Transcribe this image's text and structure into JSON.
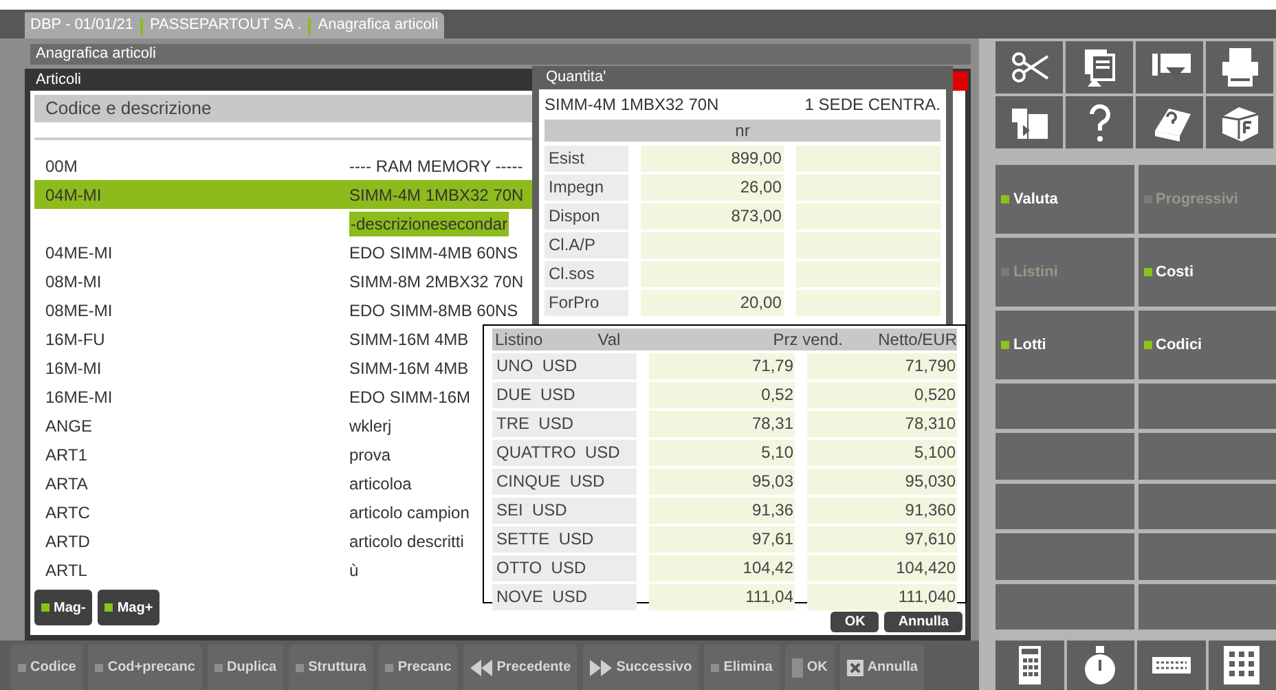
{
  "tab": {
    "parts": [
      "DBP - 01/01/21",
      "PASSEPARTOUT SA .",
      "Anagrafica articoli"
    ]
  },
  "window": {
    "title": "Anagrafica articoli"
  },
  "articoli": {
    "title": "Articoli",
    "header": "Codice e descrizione",
    "rows": [
      {
        "code": "00M",
        "description": "---- RAM MEMORY -----",
        "selected": false
      },
      {
        "code": "04M-MI",
        "description": "SIMM-4M 1MBX32 70N",
        "selected": true,
        "secondary": "-descrizionesecondar"
      },
      {
        "code": "04ME-MI",
        "description": "EDO SIMM-4MB 60NS",
        "selected": false
      },
      {
        "code": "08M-MI",
        "description": "SIMM-8M 2MBX32 70N",
        "selected": false
      },
      {
        "code": "08ME-MI",
        "description": "EDO SIMM-8MB 60NS",
        "selected": false
      },
      {
        "code": "16M-FU",
        "description": "SIMM-16M 4MB",
        "selected": false
      },
      {
        "code": "16M-MI",
        "description": "SIMM-16M 4MB",
        "selected": false
      },
      {
        "code": "16ME-MI",
        "description": "EDO SIMM-16M",
        "selected": false
      },
      {
        "code": "ANGE",
        "description": "wklerj",
        "selected": false
      },
      {
        "code": "ART1",
        "description": "prova",
        "selected": false
      },
      {
        "code": "ARTA",
        "description": "articoloa",
        "selected": false
      },
      {
        "code": "ARTC",
        "description": "articolo campion",
        "selected": false
      },
      {
        "code": "ARTD",
        "description": "articolo descritti",
        "selected": false
      },
      {
        "code": "ARTL",
        "description": "ù",
        "selected": false
      }
    ],
    "buttons": [
      {
        "label": "Mag-",
        "active": true
      },
      {
        "label": "Mag+",
        "active": true
      }
    ],
    "dialog_buttons": [
      "OK",
      "Annulla"
    ]
  },
  "quantita": {
    "title": "Quantita'",
    "item": "SIMM-4M 1MBX32 70N",
    "site": "1 SEDE CENTRA.",
    "unit": "nr",
    "rows": [
      {
        "label": "Esist",
        "value": "899,00"
      },
      {
        "label": "Impegn",
        "value": "26,00"
      },
      {
        "label": "Dispon",
        "value": "873,00"
      },
      {
        "label": "Cl.A/P"
      },
      {
        "label": "Cl.sos"
      },
      {
        "label": "ForPro",
        "value": "20,00"
      }
    ]
  },
  "listini": {
    "columns": [
      "Listino",
      "Val",
      "Prz vend.",
      "Netto/EUR"
    ],
    "rows": [
      {
        "name": "UNO",
        "currency": "USD",
        "price": "71,79",
        "net": "71,790"
      },
      {
        "name": "DUE",
        "currency": "USD",
        "price": "0,52",
        "net": "0,520"
      },
      {
        "name": "TRE",
        "currency": "USD",
        "price": "78,31",
        "net": "78,310"
      },
      {
        "name": "QUATTRO",
        "currency": "USD",
        "price": "5,10",
        "net": "5,100"
      },
      {
        "name": "CINQUE",
        "currency": "USD",
        "price": "95,03",
        "net": "95,030"
      },
      {
        "name": "SEI",
        "currency": "USD",
        "price": "91,36",
        "net": "91,360"
      },
      {
        "name": "SETTE",
        "currency": "USD",
        "price": "97,61",
        "net": "97,610"
      },
      {
        "name": "OTTO",
        "currency": "USD",
        "price": "104,42",
        "net": "104,420"
      },
      {
        "name": "NOVE",
        "currency": "USD",
        "price": "111,04",
        "net": "111,040"
      }
    ]
  },
  "side_buttons": [
    {
      "label": "Valuta",
      "disabled": false
    },
    {
      "label": "Progressivi",
      "disabled": true
    },
    {
      "label": "Listini",
      "disabled": true
    },
    {
      "label": "Costi",
      "disabled": false
    },
    {
      "label": "Lotti",
      "disabled": false
    },
    {
      "label": "Codici",
      "disabled": false
    }
  ],
  "toolbar": [
    {
      "label": "Codice",
      "kind": "square"
    },
    {
      "label": "Cod+precanc",
      "kind": "square"
    },
    {
      "label": "Duplica",
      "kind": "square"
    },
    {
      "label": "Struttura",
      "kind": "square"
    },
    {
      "label": "Precanc",
      "kind": "square"
    },
    {
      "label": "Precedente",
      "kind": "prev"
    },
    {
      "label": "Successivo",
      "kind": "next"
    },
    {
      "label": "Elimina",
      "kind": "square"
    },
    {
      "label": "OK",
      "kind": "block"
    },
    {
      "label": "Annulla",
      "kind": "cancel"
    }
  ]
}
